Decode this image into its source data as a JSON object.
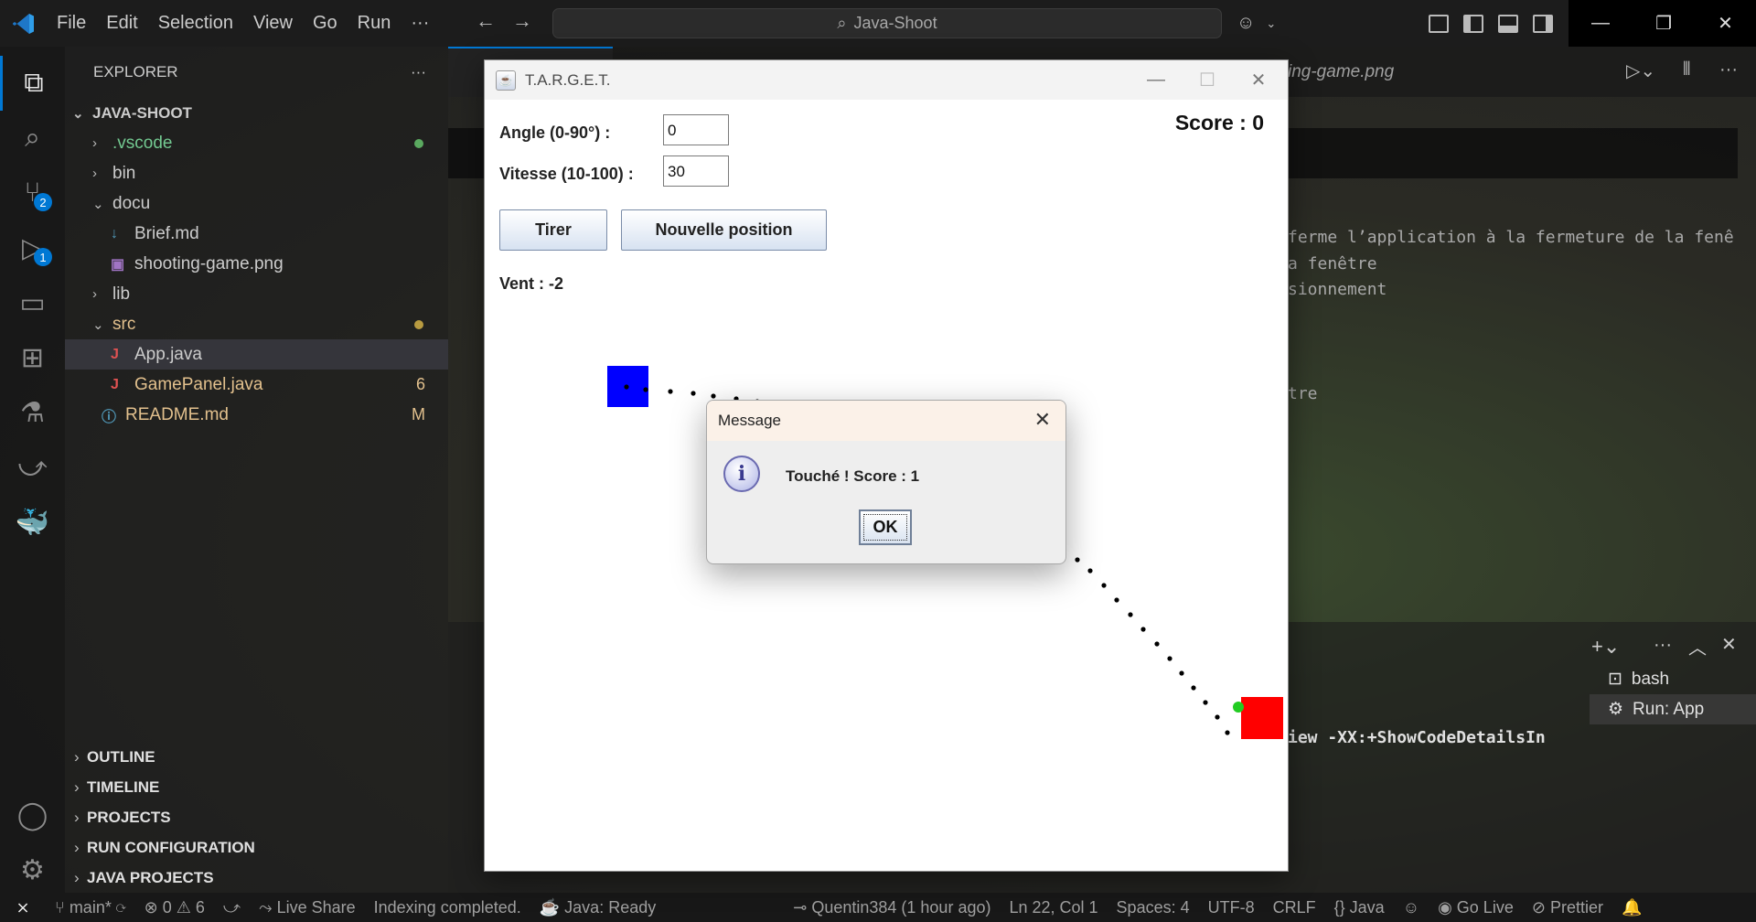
{
  "titlebar": {
    "menu": [
      "File",
      "Edit",
      "Selection",
      "View",
      "Go",
      "Run",
      "···"
    ],
    "search_text": "Java-Shoot",
    "back_icon": "arrow-left-icon",
    "forward_icon": "arrow-right-icon"
  },
  "activity": {
    "items": [
      {
        "name": "explorer-icon",
        "glyph": "⧉",
        "badge": ""
      },
      {
        "name": "search-icon",
        "glyph": "⌕",
        "badge": ""
      },
      {
        "name": "source-control-icon",
        "glyph": "⑂",
        "badge": "2"
      },
      {
        "name": "run-debug-icon",
        "glyph": "▷",
        "badge": "1"
      },
      {
        "name": "remote-explorer-icon",
        "glyph": "▭",
        "badge": ""
      },
      {
        "name": "extensions-icon",
        "glyph": "⊞",
        "badge": ""
      },
      {
        "name": "testing-icon",
        "glyph": "⚗",
        "badge": ""
      },
      {
        "name": "live-share-icon",
        "glyph": "⤻",
        "badge": ""
      },
      {
        "name": "docker-icon",
        "glyph": "🐳",
        "badge": ""
      }
    ],
    "bottom": [
      {
        "name": "account-icon",
        "glyph": "◯"
      },
      {
        "name": "settings-gear-icon",
        "glyph": "⚙"
      }
    ]
  },
  "explorer": {
    "title": "EXPLORER",
    "more": "···",
    "project": "JAVA-SHOOT",
    "tree": [
      {
        "label": ".vscode",
        "indent": 1,
        "chev": "›",
        "color": "green",
        "deco": "dot-green"
      },
      {
        "label": "bin",
        "indent": 1,
        "chev": "›",
        "color": "",
        "deco": ""
      },
      {
        "label": "docu",
        "indent": 1,
        "chev": "⌄",
        "color": "",
        "deco": ""
      },
      {
        "label": "Brief.md",
        "indent": 2,
        "chev": "",
        "color": "",
        "deco": "",
        "icon": "↓"
      },
      {
        "label": "shooting-game.png",
        "indent": 2,
        "chev": "",
        "color": "",
        "deco": "",
        "icon": "▣"
      },
      {
        "label": "lib",
        "indent": 1,
        "chev": "›",
        "color": "",
        "deco": ""
      },
      {
        "label": "src",
        "indent": 1,
        "chev": "⌄",
        "color": "yellow",
        "deco": "dot-yellow"
      },
      {
        "label": "App.java",
        "indent": 2,
        "chev": "",
        "color": "",
        "deco": "",
        "icon": "J",
        "selected": true
      },
      {
        "label": "GamePanel.java",
        "indent": 2,
        "chev": "",
        "color": "yellow",
        "deco": "6",
        "icon": "J"
      },
      {
        "label": "README.md",
        "indent": 1,
        "chev": "",
        "color": "yellow",
        "deco": "M",
        "icon": "ⓘ"
      }
    ],
    "sections": [
      "OUTLINE",
      "TIMELINE",
      "PROJECTS",
      "RUN CONFIGURATION",
      "JAVA PROJECTS"
    ]
  },
  "editor": {
    "tab_fragment": "ing-game.png",
    "code_lines": [
      "ferme l’application à la fermeture de la fenê",
      "a fenêtre",
      "sionnement",
      "tre"
    ],
    "terminal_text": "iew -XX:+ShowCodeDetailsIn",
    "terminal_items": [
      {
        "label": "bash",
        "icon": "terminal-icon"
      },
      {
        "label": "Run: App",
        "icon": "debug-icon"
      }
    ]
  },
  "java_window": {
    "title": "T.A.R.G.E.T.",
    "angle_label": "Angle (0-90°) :",
    "angle_value": "0",
    "speed_label": "Vitesse (10-100) :",
    "speed_value": "30",
    "fire_button": "Tirer",
    "new_position_button": "Nouvelle position",
    "wind_label": "Vent : -2",
    "score_label": "Score : 0"
  },
  "dialog": {
    "title": "Message",
    "message": "Touché ! Score : 1",
    "ok": "OK"
  },
  "statusbar": {
    "branch": "main*",
    "errors": "0",
    "warnings": "6",
    "live_share": "Live Share",
    "indexing": "Indexing completed.",
    "java_status": "Java: Ready",
    "commit": "Quentin384 (1 hour ago)",
    "cursor": "Ln 22, Col 1",
    "spaces": "Spaces: 4",
    "encoding": "UTF-8",
    "eol": "CRLF",
    "language": "Java",
    "go_live": "Go Live",
    "prettier": "Prettier"
  },
  "colors": {
    "accent": "#0078d4",
    "shooter": "#0000ff",
    "target": "#ff0000",
    "impact": "#22cc22",
    "trajectory": "#000000"
  }
}
